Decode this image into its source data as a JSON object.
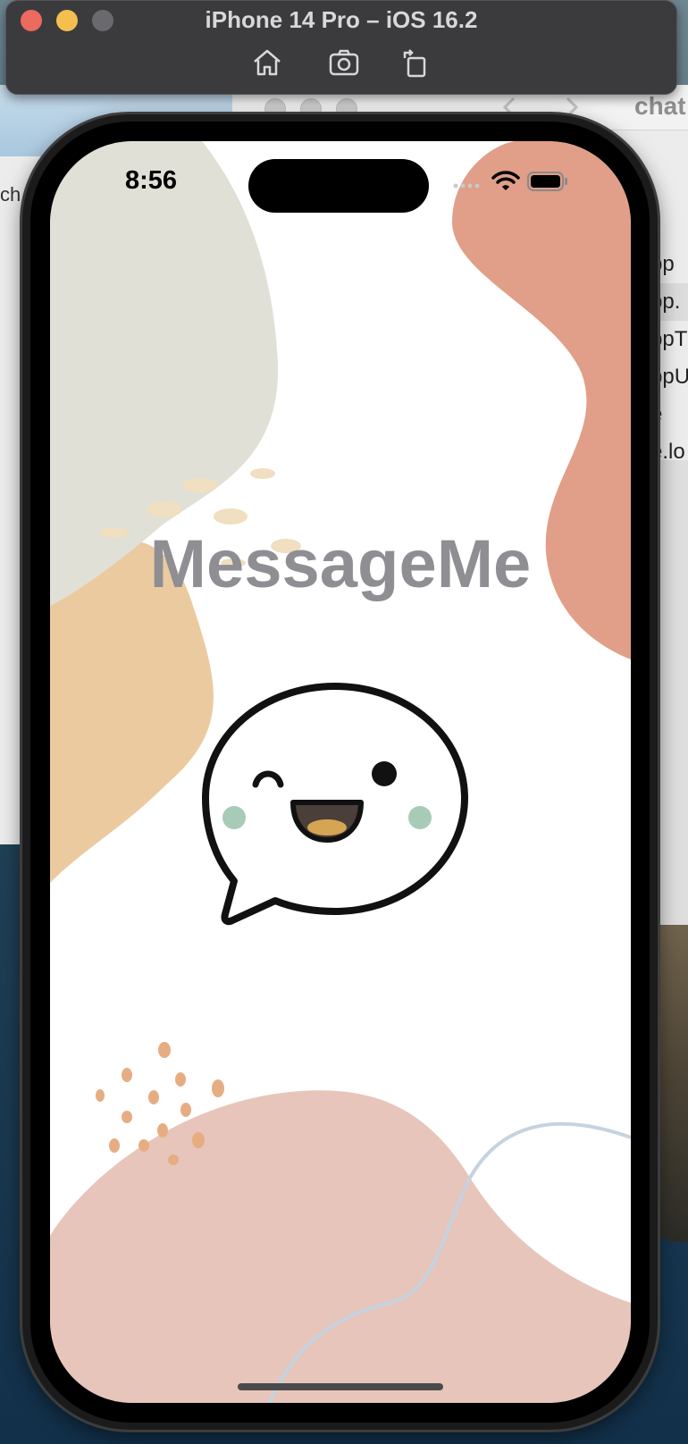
{
  "simulator": {
    "window_title": "iPhone 14 Pro – iOS 16.2",
    "toolbar": [
      "home-icon",
      "screenshot-icon",
      "rotate-icon"
    ]
  },
  "xcode": {
    "tab_title": "chat",
    "left_label": "ch",
    "file_list": [
      "pp",
      "pp.",
      "ppT",
      "ppU",
      "e",
      "e.lo"
    ]
  },
  "status_bar": {
    "time": "8:56",
    "icons": [
      "signal-icon",
      "wifi-icon",
      "battery-icon"
    ]
  },
  "app": {
    "title": "MessageMe",
    "logo": "chat-bubble-smiley-icon"
  },
  "colors": {
    "title": "#8e8e93",
    "blob_gray": "#e0e0d6",
    "blob_peach": "#eccaa0",
    "blob_terracotta": "#e19e88",
    "blob_pink": "#e7c5bb",
    "cheek": "#a8cbb7",
    "tongue": "#d6a553"
  }
}
